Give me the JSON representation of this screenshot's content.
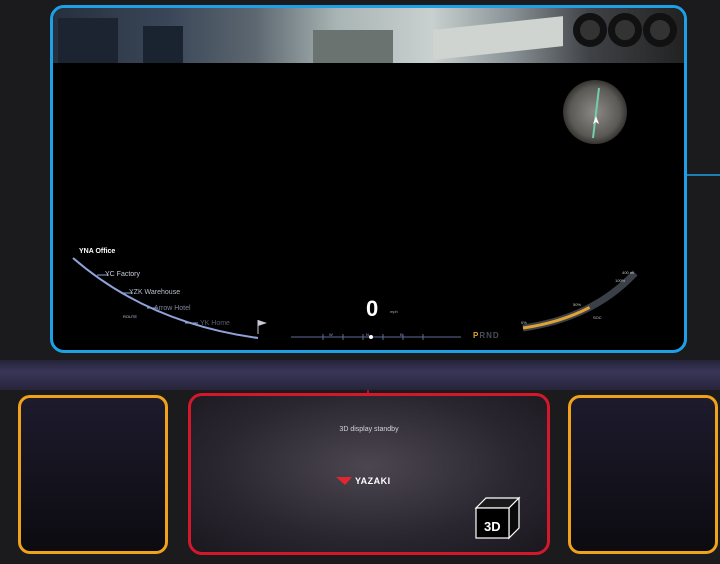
{
  "colors": {
    "main_frame": "#1ea0e6",
    "center_frame": "#d4182b",
    "side_frames": "#f0a21a",
    "gauge_fill": "#e0a235",
    "route_line": "#8fa3d8"
  },
  "cluster": {
    "route": {
      "origin": "YNA Office",
      "stops": [
        "YC Factory",
        "YZK Warehouse",
        "Arrow Hotel",
        "YK Home"
      ],
      "route_label": "ROUTE"
    },
    "speed": {
      "value": "0",
      "unit": "mph"
    },
    "compass": [
      "W",
      "N",
      "E"
    ],
    "gear": {
      "letters": [
        "P",
        "R",
        "N",
        "D"
      ],
      "selected": "P"
    },
    "gauge": {
      "labels": {
        "range": " 400 mi",
        "pct_100": "100%",
        "pct_50": "50%",
        "pct_0": "0%",
        "soc": "SOC"
      },
      "fill_fraction": 0.55
    },
    "icons": [
      "flag-icon",
      "nav-arrow-icon"
    ]
  },
  "center_display": {
    "standby_text": "3D display standby",
    "brand": "YAZAKI",
    "badge_text": "3D"
  }
}
